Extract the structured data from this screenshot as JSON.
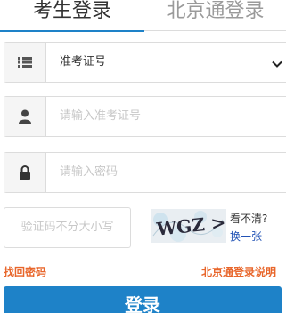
{
  "tabs": {
    "active": "考生登录",
    "inactive": "北京通登录"
  },
  "form": {
    "type_select": {
      "value": "准考证号",
      "icon": "list-icon"
    },
    "id_field": {
      "placeholder": "请输入准考证号",
      "icon": "user-icon"
    },
    "password_field": {
      "placeholder": "请输入密码",
      "icon": "lock-icon"
    },
    "captcha": {
      "placeholder": "验证码不分大小写",
      "image_text": "WGZ >",
      "hint": "看不清?",
      "refresh": "换一张"
    }
  },
  "links": {
    "forgot_password": "找回密码",
    "beijingtong_help": "北京通登录说明"
  },
  "login_button": "登录",
  "colors": {
    "accent": "#1e82c8",
    "link_orange": "#e8662b",
    "refresh_link": "#1e50b4",
    "border": "#dcdcdc",
    "placeholder": "#c8c8c8"
  }
}
